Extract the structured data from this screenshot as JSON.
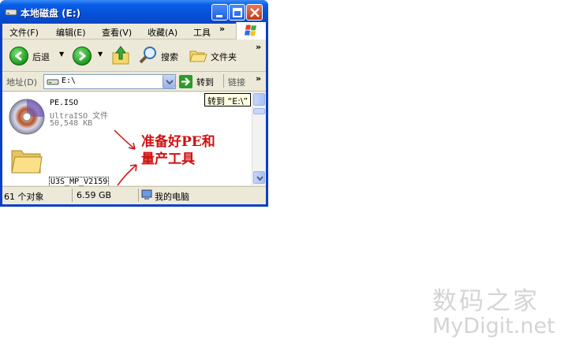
{
  "window": {
    "title": "本地磁盘 (E:)"
  },
  "menubar": {
    "items": [
      {
        "label": "文件(F)"
      },
      {
        "label": "编辑(E)"
      },
      {
        "label": "查看(V)"
      },
      {
        "label": "收藏(A)"
      },
      {
        "label": "工具"
      }
    ],
    "overflow": "»"
  },
  "toolbar": {
    "back_label": "后退",
    "search_label": "搜索",
    "folders_label": "文件夹",
    "overflow": "»"
  },
  "addressbar": {
    "label": "地址(D)",
    "value": "E:\\",
    "go_label": "转到",
    "links_label": "链接",
    "overflow": "»"
  },
  "tooltip": {
    "text": "转到 “E:\\”"
  },
  "files": [
    {
      "name": "PE.ISO",
      "type": "UltraISO 文件",
      "size": "50,548 KB",
      "icon": "disc-icon"
    },
    {
      "name": "U3S_MP_V2159",
      "icon": "folder-icon"
    }
  ],
  "annotation": {
    "line1": "准备好PE和",
    "line2": "量产工具",
    "color": "#d01010"
  },
  "statusbar": {
    "count": "61 个对象",
    "size": "6.59 GB",
    "location": "我的电脑"
  },
  "watermark": {
    "line1": "数码之家",
    "line2": "MyDigit.net"
  }
}
